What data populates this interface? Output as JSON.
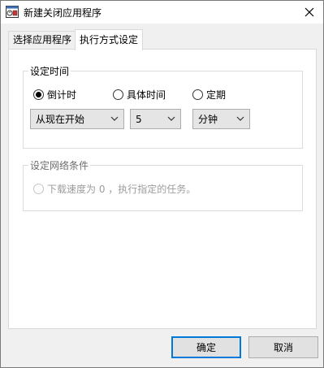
{
  "window": {
    "title": "新建关闭应用程序"
  },
  "tabs": [
    {
      "label": "选择应用程序",
      "selected": false
    },
    {
      "label": "执行方式设定",
      "selected": true
    }
  ],
  "schedule_group": {
    "legend": "设定时间",
    "options": [
      {
        "label": "倒计时",
        "checked": true
      },
      {
        "label": "具体时间",
        "checked": false
      },
      {
        "label": "定期",
        "checked": false
      }
    ],
    "start_select": "从现在开始",
    "amount_select": "5",
    "unit_select": "分钟"
  },
  "network_group": {
    "legend": "设定网络条件",
    "option": {
      "label": "下载速度为 0 ，执行指定的任务。",
      "checked": false,
      "enabled": false
    }
  },
  "buttons": {
    "ok": "确定",
    "cancel": "取消"
  },
  "colors": {
    "accent": "#0078d7",
    "panel": "#ffffff",
    "window_bg": "#f0f0f0",
    "disabled_text": "#9c9c9c"
  }
}
